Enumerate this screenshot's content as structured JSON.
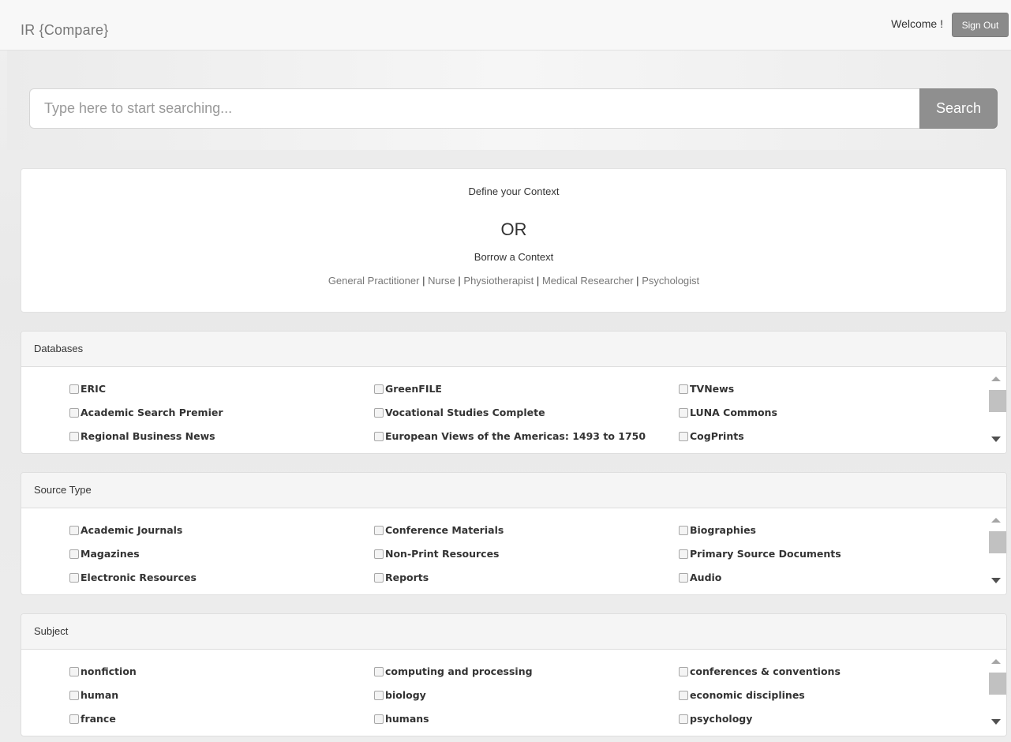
{
  "app": {
    "title": "IR  {Compare}",
    "welcome": "Welcome !",
    "signout_label": "Sign Out"
  },
  "search": {
    "placeholder": "Type here to start searching...",
    "button_label": "Search"
  },
  "context": {
    "define_label": "Define your Context",
    "or_label": "OR",
    "borrow_label": "Borrow a Context",
    "roles": [
      "General Practitioner",
      "Nurse",
      "Physiotherapist",
      "Medical Researcher",
      "Psychologist"
    ],
    "separator": "|"
  },
  "panels": [
    {
      "heading": "Databases",
      "rows": [
        [
          "ERIC",
          "GreenFILE",
          "TVNews"
        ],
        [
          "Academic Search Premier",
          "Vocational Studies Complete",
          "LUNA Commons"
        ],
        [
          "Regional Business News",
          "European Views of the Americas: 1493 to 1750",
          "CogPrints"
        ]
      ]
    },
    {
      "heading": "Source Type",
      "rows": [
        [
          "Academic Journals",
          "Conference Materials",
          "Biographies"
        ],
        [
          "Magazines",
          "Non-Print Resources",
          "Primary Source Documents"
        ],
        [
          "Electronic Resources",
          "Reports",
          "Audio"
        ]
      ]
    },
    {
      "heading": "Subject",
      "rows": [
        [
          "nonfiction",
          "computing and processing",
          "conferences & conventions"
        ],
        [
          "human",
          "biology",
          "economic disciplines"
        ],
        [
          "france",
          "humans",
          "psychology"
        ]
      ]
    }
  ],
  "colors": {
    "navbar_bg": "#f8f8f8",
    "button_gray": "#8f8f8f",
    "panel_heading_bg": "#f5f5f5",
    "muted_text": "#777777"
  },
  "icons": {
    "checkbox": "checkbox-icon",
    "scroll_up": "scroll-up-arrow-icon",
    "scroll_down": "scroll-down-arrow-icon"
  }
}
